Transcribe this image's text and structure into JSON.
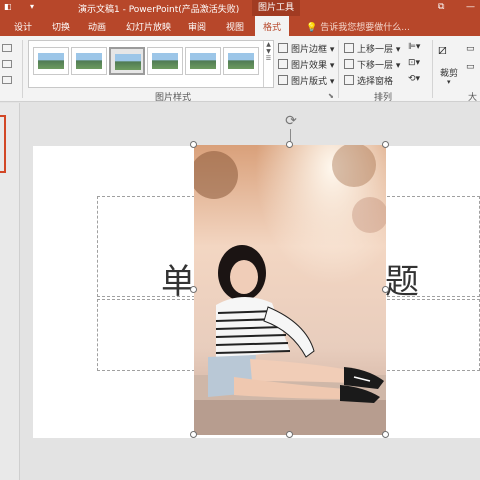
{
  "titlebar": {
    "title": "演示文稿1 - PowerPoint(产品激活失败)",
    "context_tools": "图片工具",
    "qat_icon": "dropdown-arrow-icon",
    "win_icon": "ribbon-display-icon"
  },
  "tabs": [
    "设计",
    "切换",
    "动画",
    "幻灯片放映",
    "审阅",
    "视图"
  ],
  "active_tab": "格式",
  "tell_me": "告诉我您想要做什么...",
  "ribbon": {
    "picture_styles_label": "图片样式",
    "border_label": "图片边框",
    "effects_label": "图片效果",
    "layout_label": "图片版式",
    "bring_forward": "上移一层",
    "send_backward": "下移一层",
    "selection_pane": "选择窗格",
    "arrange_label": "排列",
    "crop_label": "裁剪",
    "size_label": "大"
  },
  "slide": {
    "title_left": "单",
    "title_right": "题"
  },
  "colors": {
    "accent": "#b7472a",
    "ribbon_bg": "#f3f3f3",
    "workspace_bg": "#e3e3e3"
  }
}
